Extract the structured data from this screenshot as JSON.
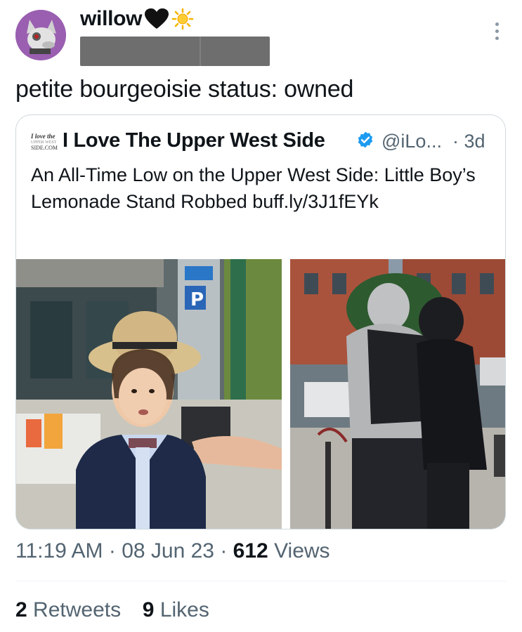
{
  "tweet": {
    "author_name": "willow",
    "name_emojis": [
      "black-heart-icon",
      "sun-icon"
    ],
    "text": "petite bourgeoisie status: owned",
    "time": "11:19 AM",
    "date": "08 Jun 23",
    "views_count": "612",
    "views_label": "Views",
    "retweets_count": "2",
    "retweets_label": "Retweets",
    "likes_count": "9",
    "likes_label": "Likes"
  },
  "quote": {
    "logo_lines": [
      "I love the",
      "UPPER WEST",
      "SIDE.COM"
    ],
    "author_name": "I Love The Upper West Side",
    "handle": "@iLo...",
    "time": "3d",
    "text": "An All-Time Low on the Upper West Side: Little Boy’s Lemonade Stand Robbed buff.ly/3J1fEYk",
    "verified_color": "#1d9bf0",
    "photos": [
      "boy-in-straw-hat-photo",
      "hooded-figures-photo"
    ]
  },
  "colors": {
    "secondary_text": "#536471",
    "primary_text": "#0f1419",
    "avatar_bg": "#9a5fb0",
    "redaction": "#6e6e6e"
  }
}
